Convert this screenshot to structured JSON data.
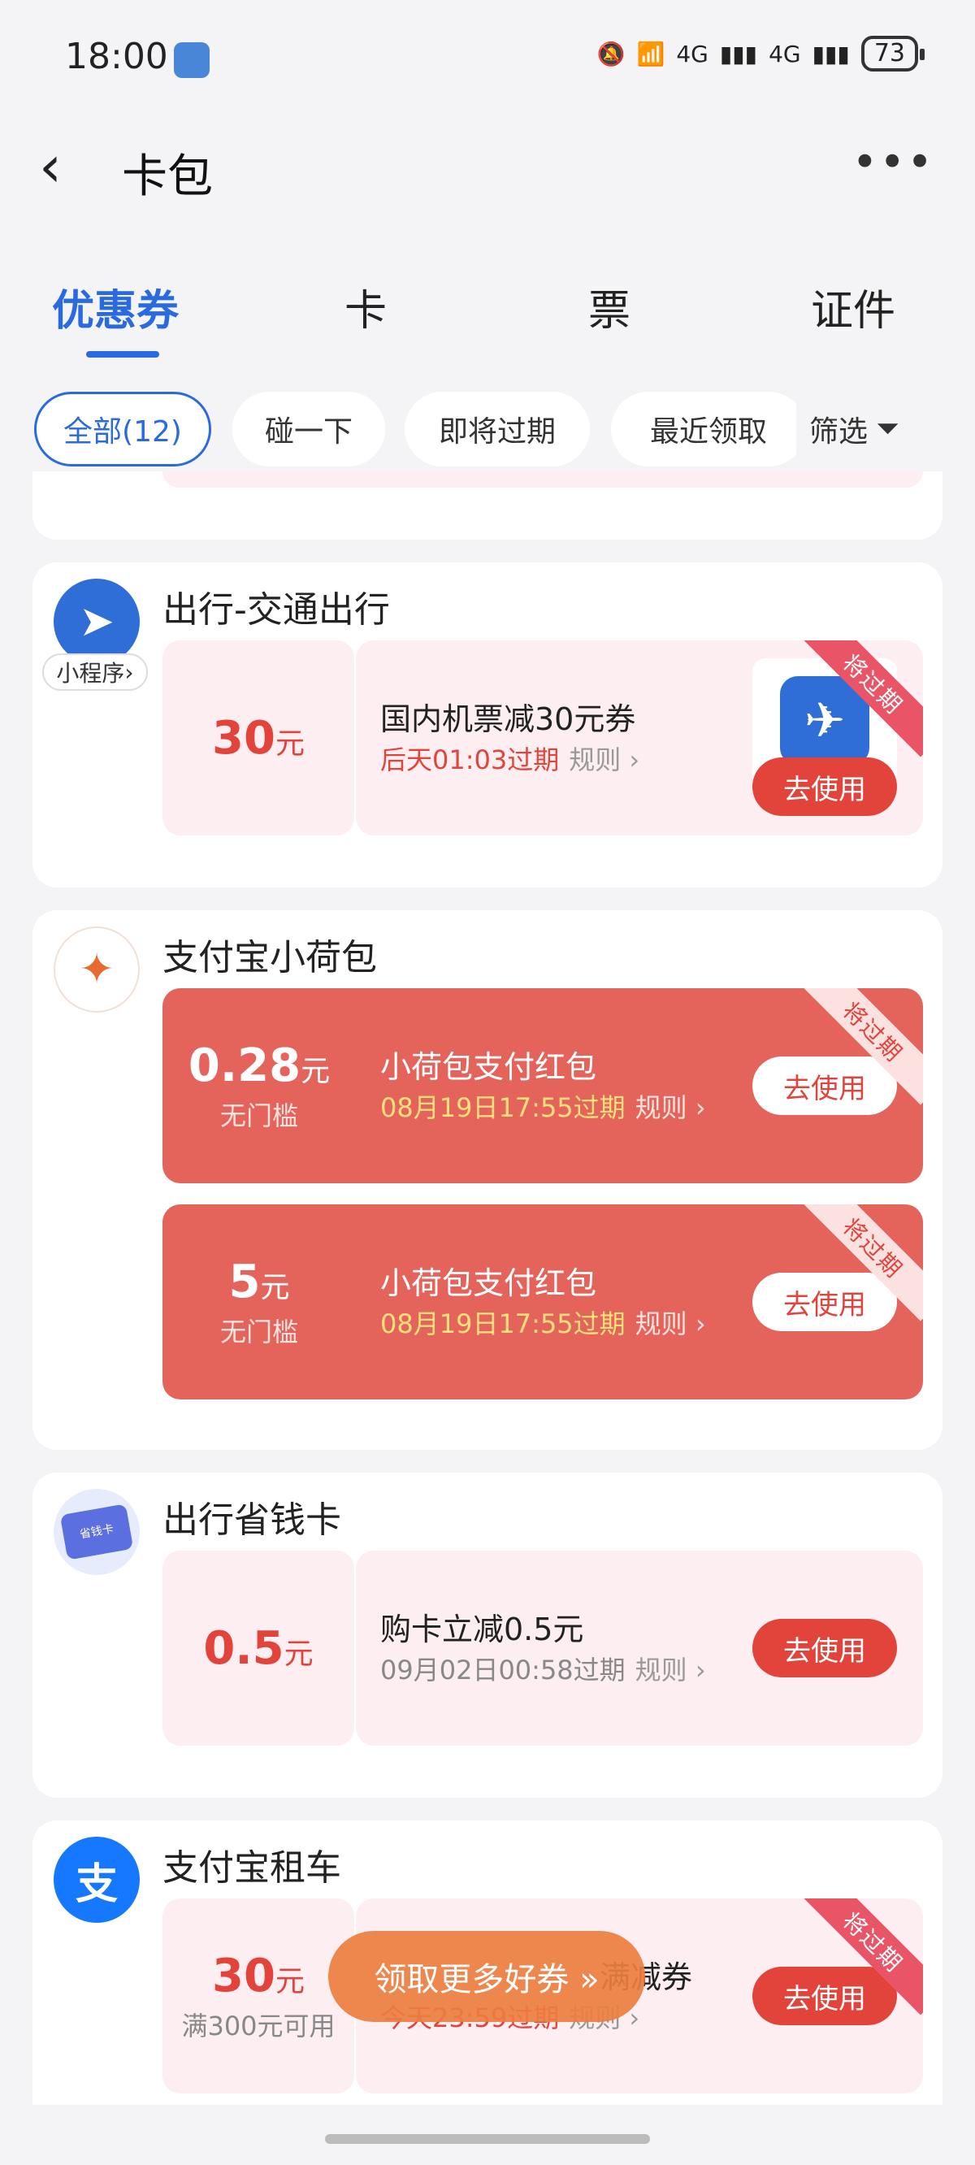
{
  "status_bar": {
    "time": "18:00",
    "network1": "4G",
    "network2": "4G",
    "battery": "73"
  },
  "header": {
    "title": "卡包",
    "more": "•••"
  },
  "tabs": [
    {
      "label": "优惠券",
      "active": true
    },
    {
      "label": "卡",
      "active": false
    },
    {
      "label": "票",
      "active": false
    },
    {
      "label": "证件",
      "active": false
    }
  ],
  "filters": [
    {
      "label": "全部(12)",
      "active": true
    },
    {
      "label": "碰一下",
      "active": false
    },
    {
      "label": "即将过期",
      "active": false
    },
    {
      "label": "最近领取",
      "active": false
    }
  ],
  "filter_button": "筛选",
  "groups": [
    {
      "brand": "出行-交通出行",
      "mini_program_label": "小程序",
      "coupons": [
        {
          "amount": "30",
          "unit": "元",
          "name": "国内机票减30元券",
          "expire": "后天01:03过期",
          "rule": "规则",
          "action": "去使用",
          "ribbon": "将过期"
        }
      ]
    },
    {
      "brand": "支付宝小荷包",
      "coupons": [
        {
          "amount": "0.28",
          "unit": "元",
          "sub": "无门槛",
          "name": "小荷包支付红包",
          "expire": "08月19日17:55过期",
          "rule": "规则",
          "action": "去使用",
          "ribbon": "将过期"
        },
        {
          "amount": "5",
          "unit": "元",
          "sub": "无门槛",
          "name": "小荷包支付红包",
          "expire": "08月19日17:55过期",
          "rule": "规则",
          "action": "去使用",
          "ribbon": "将过期"
        }
      ]
    },
    {
      "brand": "出行省钱卡",
      "logo_text": "省钱卡",
      "coupons": [
        {
          "amount": "0.5",
          "unit": "元",
          "name": "购卡立减0.5元",
          "expire": "09月02日00:58过期",
          "rule": "规则",
          "action": "去使用"
        }
      ]
    },
    {
      "brand": "支付宝租车",
      "logo_text": "支",
      "coupons": [
        {
          "amount": "30",
          "unit": "元",
          "sub": "满300元可用",
          "name": "满减券",
          "expire": "今天23:59过期",
          "rule": "规则",
          "action": "去使用",
          "ribbon": "将过期"
        }
      ]
    }
  ],
  "floating_button": "领取更多好券 »",
  "colors": {
    "accent": "#2a6ae0",
    "coupon_red": "#e2433a",
    "red_card": "#e4645b",
    "pink_bg": "#fdeff1"
  }
}
